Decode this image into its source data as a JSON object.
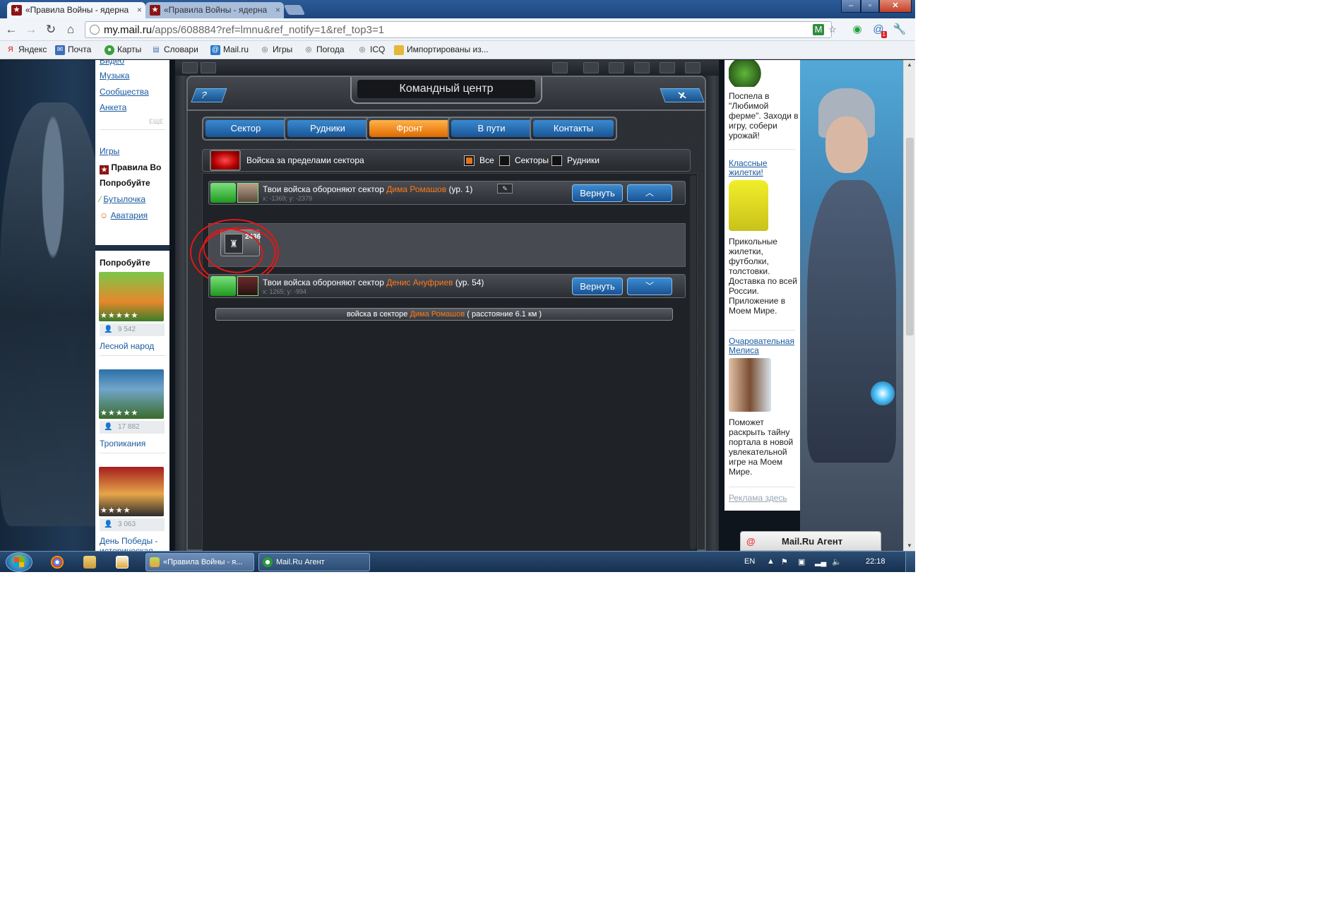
{
  "browser": {
    "tabs": [
      {
        "title": "«Правила Войны - ядерна",
        "favicon": "star-favicon-icon"
      },
      {
        "title": "«Правила Войны - ядерна",
        "favicon": "star-favicon-icon"
      }
    ],
    "url_host": "my.mail.ru",
    "url_path": "/apps/608884?ref=lmnu&ref_notify=1&ref_top3=1",
    "bookmarks": [
      "Яндекс",
      "Почта",
      "Карты",
      "Словари",
      "Mail.ru",
      "Игры",
      "Погода",
      "ICQ",
      "Импортированы из..."
    ],
    "notification_badge": "1"
  },
  "leftnav": {
    "links_top": [
      "Видео",
      "Музыка",
      "Сообщества",
      "Анкета"
    ],
    "more": "ЕЩЕ",
    "games_heading": "Игры",
    "game_current": "Правила Во",
    "try_label": "Попробуйте",
    "try_links": [
      "Бутылочка",
      "Аватария"
    ]
  },
  "promo": {
    "heading": "Попробуйте",
    "games": [
      {
        "title": "Лесной народ",
        "users": "9 542",
        "stars": "★★★★★"
      },
      {
        "title": "Тропикания",
        "users": "17 882",
        "stars": "★★★★★"
      },
      {
        "title": "День Победы - историческая",
        "users": "3 063",
        "stars": "★★★★"
      }
    ]
  },
  "game": {
    "window_title": "Командный центр",
    "help": "?",
    "close": "✕",
    "tabs": [
      {
        "label": "Сектор",
        "active": false
      },
      {
        "label": "Рудники",
        "active": false
      },
      {
        "label": "Фронт",
        "active": true
      },
      {
        "label": "В пути",
        "active": false
      },
      {
        "label": "Контакты",
        "active": false
      }
    ],
    "filter": {
      "title": "Войска за пределами сектора",
      "options": [
        {
          "label": "Все",
          "checked": true
        },
        {
          "label": "Секторы",
          "checked": false
        },
        {
          "label": "Рудники",
          "checked": false
        }
      ]
    },
    "rows": [
      {
        "prefix": "Твои войска обороняют сектор",
        "player": "Дима Ромашов",
        "level": "(ур. 1)",
        "coords": "x: -1369; y: -2379",
        "return_label": "Вернуть",
        "toggle": "︿"
      },
      {
        "prefix": "Твои войска обороняют сектор",
        "player": "Денис Ануфриев",
        "level": "(ур. 54)",
        "coords": "x: 1265; y: -994",
        "return_label": "Вернуть",
        "toggle": "﹀"
      }
    ],
    "detail": {
      "prefix": "войска в секторе",
      "player": "Дима Ромашов",
      "distance": "( расстояние 6.1 км )",
      "unit_count": "2436"
    },
    "edit_icon": "✎"
  },
  "ads": [
    {
      "text": "Поспела в \"Любимой ферме\". Заходи в игру, собери урожай!"
    },
    {
      "link": "Классные жилетки!",
      "text": "Прикольные жилетки, футболки, толстовки. Доставка по всей России. Приложение в Моем Мире."
    },
    {
      "link": "Очаровательная Мелиса",
      "text": "Поможет раскрыть тайну портала в новой увлекательной игре на Моем Мире."
    }
  ],
  "ad_footer": "Реклама здесь",
  "agent": {
    "label": "Mail.Ru Агент"
  },
  "taskbar": {
    "items": [
      "«Правила Войны - я...",
      "Mail.Ru Агент"
    ],
    "lang": "EN",
    "time": "22:18"
  },
  "colors": {
    "accent_blue": "#1a5596",
    "orange_active": "#e06a00",
    "player_name": "#ff7a1a"
  }
}
